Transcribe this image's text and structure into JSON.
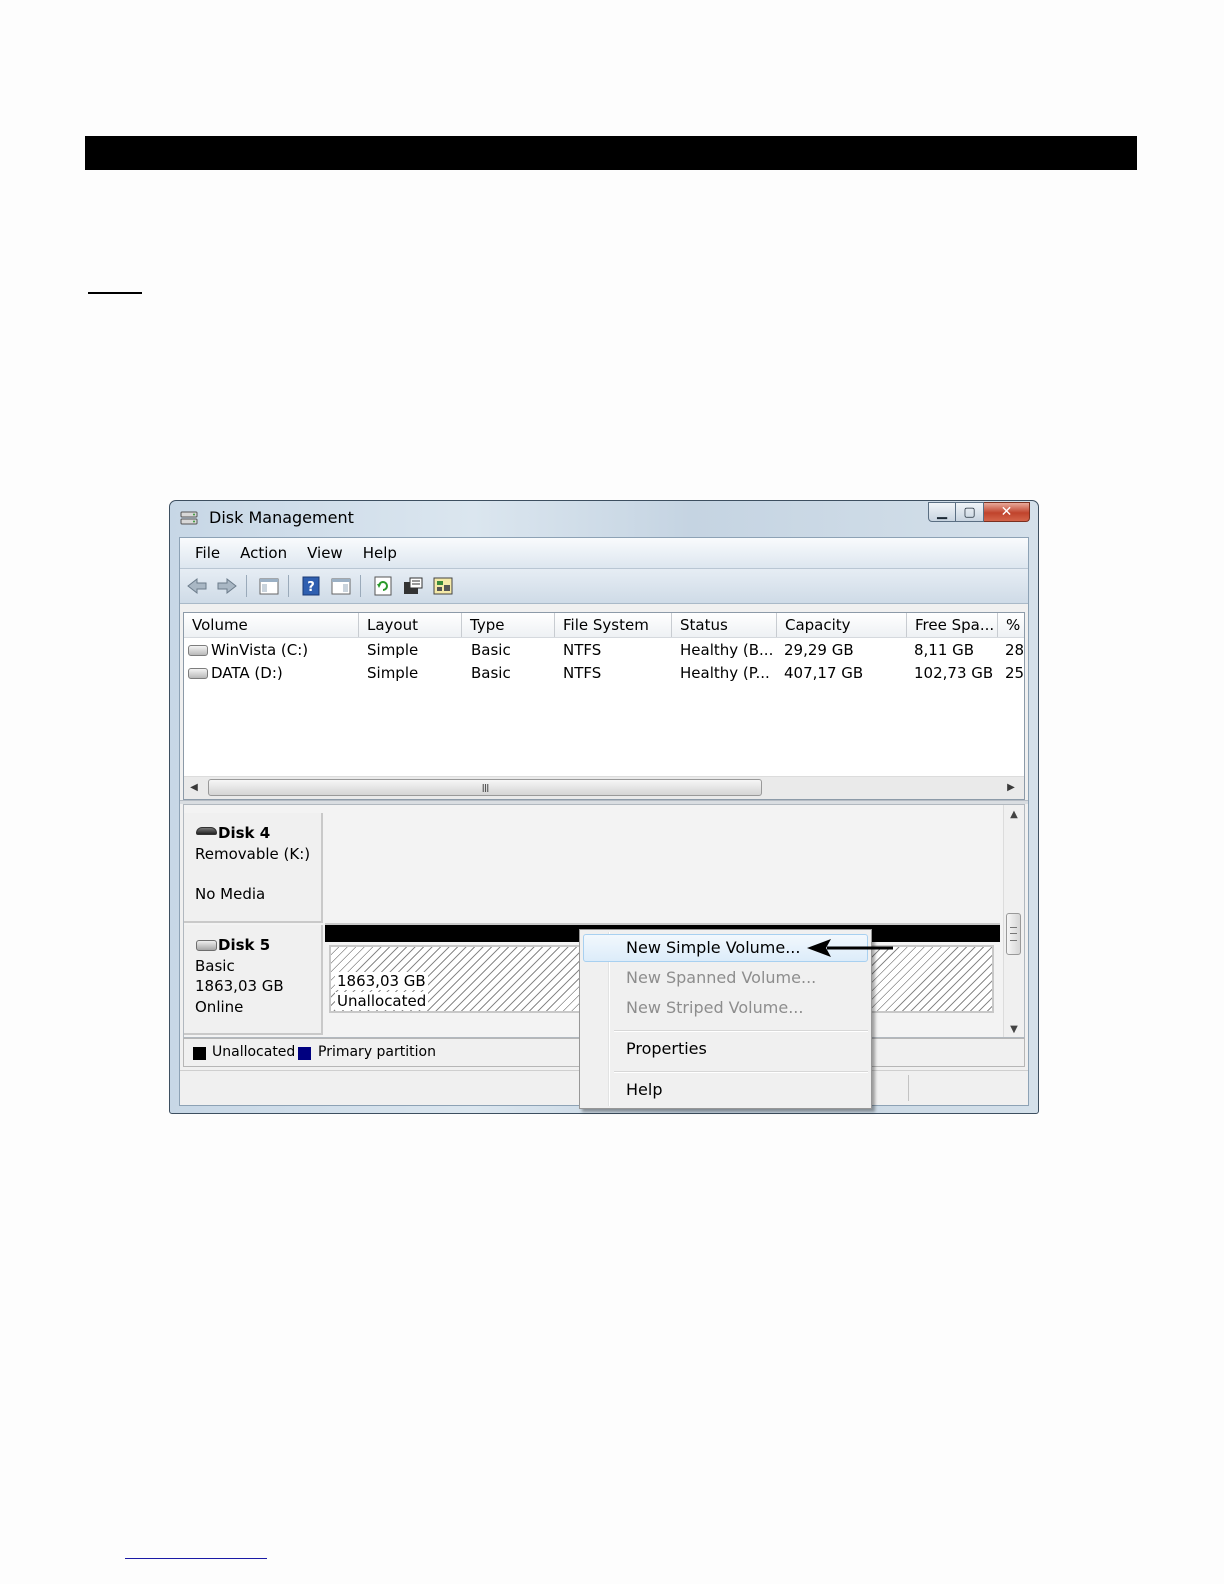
{
  "window": {
    "title": "Disk Management"
  },
  "menubar": {
    "items": [
      "File",
      "Action",
      "View",
      "Help"
    ]
  },
  "toolbar": {
    "icons": [
      "back-icon",
      "forward-icon",
      "show-hide-console-tree-icon",
      "help-icon",
      "show-hide-action-pane-icon",
      "refresh-icon",
      "properties-icon",
      "rescan-disks-icon"
    ]
  },
  "volume_list": {
    "columns": [
      "Volume",
      "Layout",
      "Type",
      "File System",
      "Status",
      "Capacity",
      "Free Spa...",
      "% F"
    ],
    "rows": [
      {
        "volume": "WinVista (C:)",
        "layout": "Simple",
        "type": "Basic",
        "fs": "NTFS",
        "status": "Healthy (B...",
        "capacity": "29,29 GB",
        "free": "8,11 GB",
        "pct": "28"
      },
      {
        "volume": "DATA (D:)",
        "layout": "Simple",
        "type": "Basic",
        "fs": "NTFS",
        "status": "Healthy (P...",
        "capacity": "407,17 GB",
        "free": "102,73 GB",
        "pct": "25"
      }
    ],
    "scroll_grip": "III"
  },
  "disks": {
    "disk4": {
      "name": "Disk 4",
      "line1": "Removable (K:)",
      "line2": "No Media"
    },
    "disk5": {
      "name": "Disk 5",
      "line1": "Basic",
      "line2": "1863,03 GB",
      "line3": "Online",
      "partition": {
        "size": "1863,03 GB",
        "label": "Unallocated"
      }
    }
  },
  "legend": {
    "items": [
      {
        "label": "Unallocated",
        "color": "#000000"
      },
      {
        "label": "Primary partition",
        "color": "#000080"
      }
    ]
  },
  "context_menu": {
    "items": [
      {
        "label": "New Simple Volume...",
        "enabled": true,
        "highlighted": true
      },
      {
        "label": "New Spanned Volume...",
        "enabled": false
      },
      {
        "label": "New Striped Volume...",
        "enabled": false
      },
      {
        "label": "Properties",
        "enabled": true
      },
      {
        "label": "Help",
        "enabled": true
      }
    ]
  },
  "colors": {
    "accent_close": "#c0432c",
    "highlight": "#dcecfa",
    "unallocated": "#000000",
    "primary_partition": "#000080"
  }
}
